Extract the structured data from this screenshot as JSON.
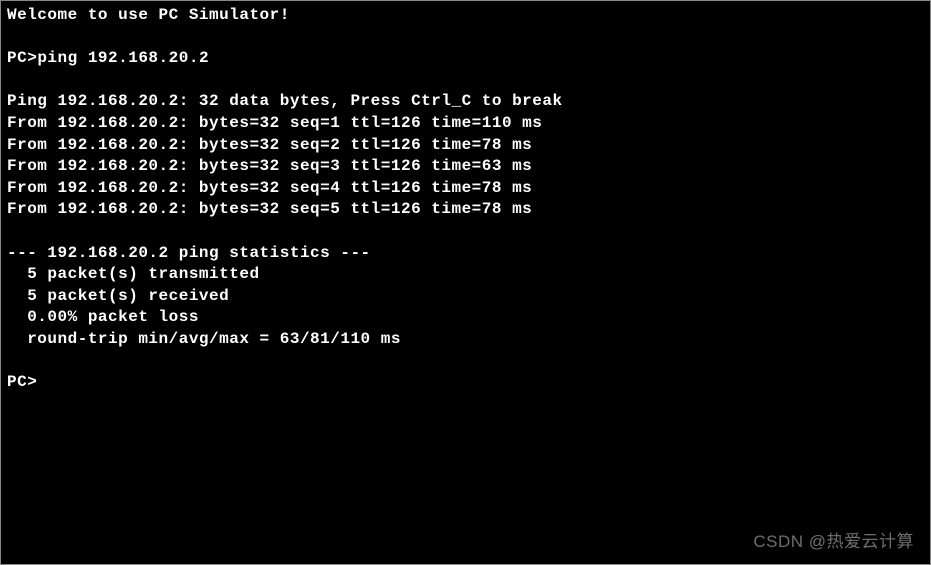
{
  "terminal": {
    "welcome": "Welcome to use PC Simulator!",
    "prompt": "PC>",
    "command": "ping 192.168.20.2",
    "ping_header": "Ping 192.168.20.2: 32 data bytes, Press Ctrl_C to break",
    "replies": [
      "From 192.168.20.2: bytes=32 seq=1 ttl=126 time=110 ms",
      "From 192.168.20.2: bytes=32 seq=2 ttl=126 time=78 ms",
      "From 192.168.20.2: bytes=32 seq=3 ttl=126 time=63 ms",
      "From 192.168.20.2: bytes=32 seq=4 ttl=126 time=78 ms",
      "From 192.168.20.2: bytes=32 seq=5 ttl=126 time=78 ms"
    ],
    "stats_header": "--- 192.168.20.2 ping statistics ---",
    "stats": [
      "  5 packet(s) transmitted",
      "  5 packet(s) received",
      "  0.00% packet loss",
      "  round-trip min/avg/max = 63/81/110 ms"
    ],
    "final_prompt": "PC>"
  },
  "watermark": "CSDN @热爱云计算"
}
